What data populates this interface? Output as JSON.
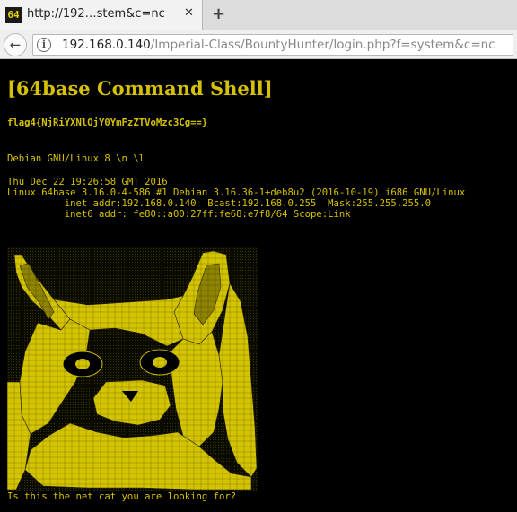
{
  "browser": {
    "tab_favicon_text": "64",
    "tab_title": "http://192…stem&c=nc",
    "tab_close_glyph": "✕",
    "new_tab_glyph": "+",
    "back_glyph": "←",
    "info_glyph": "i",
    "url_host": "192.168.0.140",
    "url_path": "/Imperial-Class/BountyHunter/login.php?f=system&c=nc"
  },
  "page": {
    "heading": "[64base Command Shell]",
    "flag": "flag4{NjRiYXNlOjY0YmFzZTVoMzc3Cg==}",
    "issue": "Debian GNU/Linux 8 \\n \\l",
    "date": "Thu Dec 22 19:26:58 GMT 2016",
    "uname": "Linux 64base 3.16.0-4-586 #1 Debian 3.16.36-1+deb8u2 (2016-10-19) i686 GNU/Linux",
    "inet": "          inet addr:192.168.0.140  Bcast:192.168.0.255  Mask:255.255.255.0",
    "inet6": "          inet6 addr: fe80::a00:27ff:fe68:e7f8/64 Scope:Link",
    "caption": "Is this the net cat you are looking for?"
  },
  "colors": {
    "text": "#d6c100",
    "background": "#000000",
    "art_fill": "#d4c400"
  },
  "ascii_art_name": "netcat-ascii-cat"
}
